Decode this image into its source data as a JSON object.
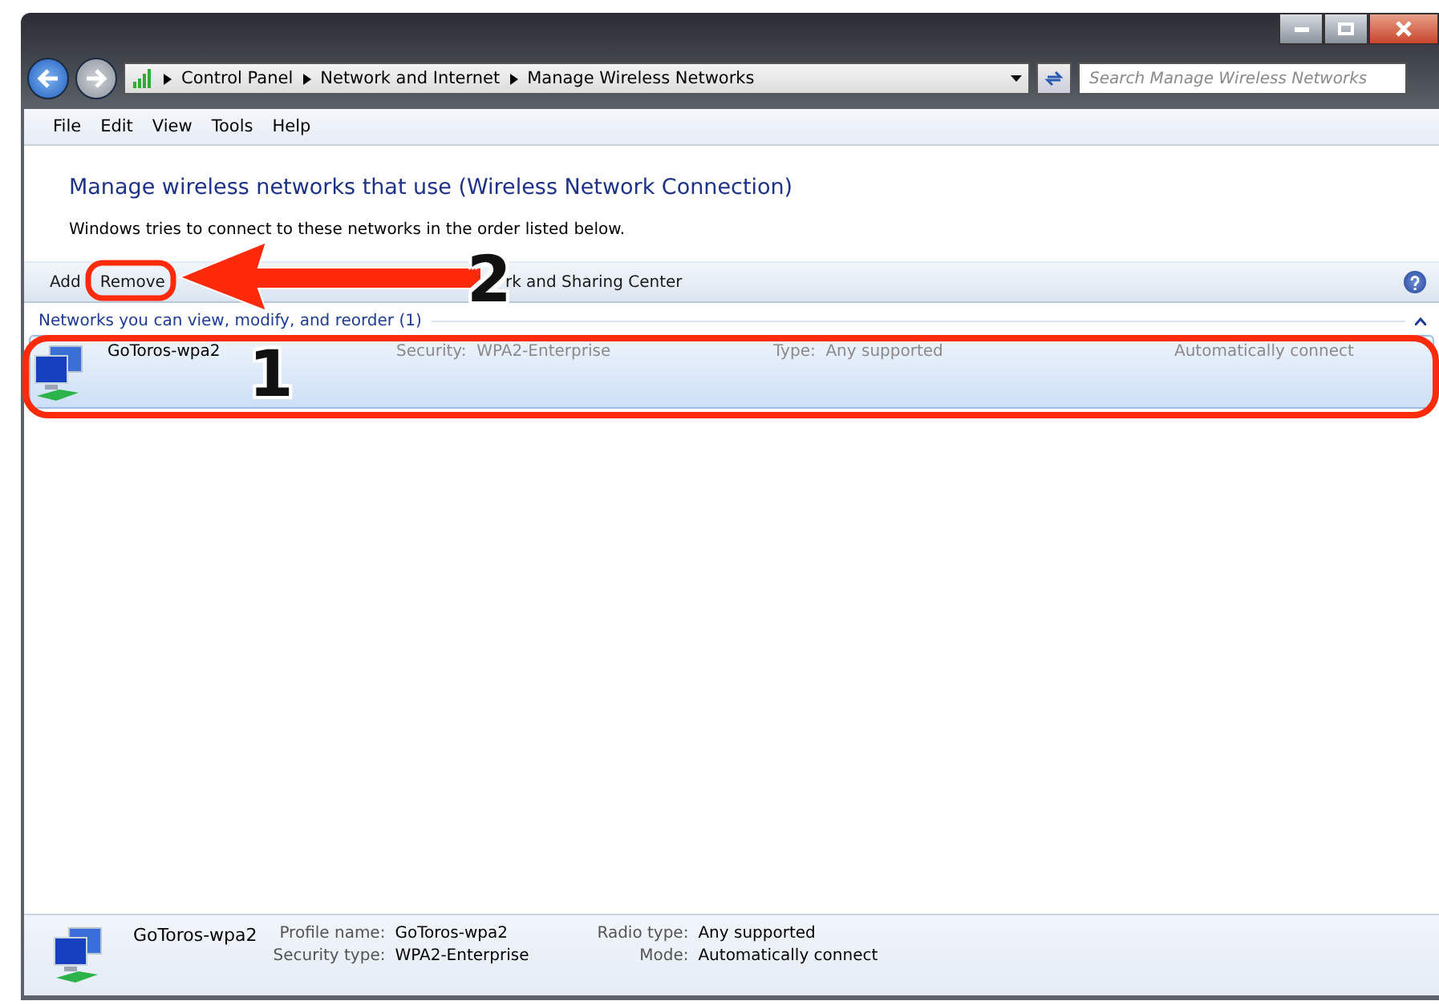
{
  "address_bar": {
    "breadcrumbs": [
      "Control Panel",
      "Network and Internet",
      "Manage Wireless Networks"
    ]
  },
  "search": {
    "placeholder": "Search Manage Wireless Networks"
  },
  "menu": [
    "File",
    "Edit",
    "View",
    "Tools",
    "Help"
  ],
  "heading": "Manage wireless networks that use (Wireless Network Connection)",
  "description": "Windows tries to connect to these networks in the order listed below.",
  "toolbar": [
    {
      "label": "Add"
    },
    {
      "label": "Remove"
    },
    {
      "label": "rk and Sharing Center"
    }
  ],
  "group": {
    "title": "Networks you can view, modify, and reorder (1)",
    "expanded": true
  },
  "networks": [
    {
      "name": "GoToros-wpa2",
      "security_label": "Security:",
      "security": "WPA2-Enterprise",
      "type_label": "Type:",
      "type": "Any supported",
      "mode": "Automatically connect",
      "selected": true
    }
  ],
  "details": {
    "name": "GoToros-wpa2",
    "fields": [
      {
        "label": "Profile name:",
        "value": "GoToros-wpa2"
      },
      {
        "label": "Security type:",
        "value": "WPA2-Enterprise"
      },
      {
        "label": "Radio type:",
        "value": "Any supported"
      },
      {
        "label": "Mode:",
        "value": "Automatically connect"
      }
    ]
  },
  "annotations": [
    {
      "label": "1"
    },
    {
      "label": "2"
    }
  ]
}
